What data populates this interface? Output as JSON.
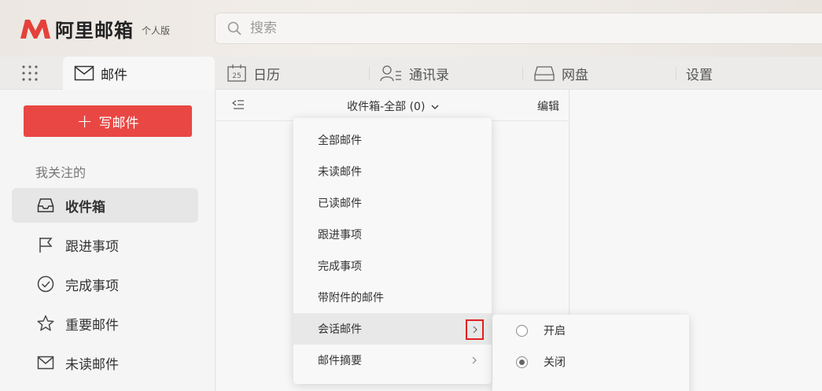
{
  "app": {
    "name": "阿里邮箱",
    "edition": "个人版",
    "brand_color": "#e5403a"
  },
  "search": {
    "placeholder": "搜索"
  },
  "tabs": [
    {
      "label": "邮件",
      "icon": "mail-icon",
      "active": true
    },
    {
      "label": "日历",
      "icon": "calendar-icon",
      "icon_text": "25"
    },
    {
      "label": "通讯录",
      "icon": "contacts-icon"
    },
    {
      "label": "网盘",
      "icon": "drive-icon"
    },
    {
      "label": "设置"
    }
  ],
  "sidebar": {
    "compose_label": "写邮件",
    "section_title": "我关注的",
    "items": [
      {
        "label": "收件箱",
        "icon": "inbox-icon",
        "active": true
      },
      {
        "label": "跟进事项",
        "icon": "flag-icon"
      },
      {
        "label": "完成事项",
        "icon": "check-circle-icon"
      },
      {
        "label": "重要邮件",
        "icon": "star-icon"
      },
      {
        "label": "未读邮件",
        "icon": "mail-icon"
      }
    ]
  },
  "list": {
    "folder_label": "收件箱-全部 (0)",
    "edit_label": "编辑"
  },
  "filter_menu": {
    "items": [
      {
        "label": "全部邮件"
      },
      {
        "label": "未读邮件"
      },
      {
        "label": "已读邮件"
      },
      {
        "label": "跟进事项"
      },
      {
        "label": "完成事项"
      },
      {
        "label": "带附件的邮件"
      },
      {
        "label": "会话邮件",
        "has_submenu": true,
        "hovered": true
      },
      {
        "label": "邮件摘要",
        "has_submenu": true
      }
    ]
  },
  "conversation_submenu": {
    "options": [
      {
        "label": "开启",
        "checked": false
      },
      {
        "label": "关闭",
        "checked": true
      }
    ]
  }
}
